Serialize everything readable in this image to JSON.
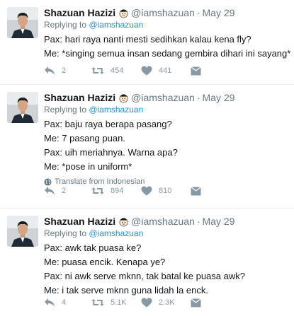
{
  "tweets": [
    {
      "name": "Shazuan Hazizi",
      "handle": "@iamshazuan",
      "sep": "·",
      "date": "May 29",
      "reply_prefix": "Replying to",
      "reply_to": "@iamshazuan",
      "lines": [
        "Pax: hari raya nanti mesti sedihkan kalau kena fly?",
        "Me: *singing semua insan sedang gembira dihari ini sayang*"
      ],
      "translate": "",
      "replies": "2",
      "retweets": "454",
      "likes": "441"
    },
    {
      "name": "Shazuan Hazizi",
      "handle": "@iamshazuan",
      "sep": "·",
      "date": "May 29",
      "reply_prefix": "Replying to",
      "reply_to": "@iamshazuan",
      "lines": [
        "Pax: baju raya berapa pasang?",
        "Me: 7 pasang puan.",
        "Pax: uih meriahnya. Warna apa?",
        "Me: *pose in uniform*"
      ],
      "translate": "Translate from Indonesian",
      "replies": "2",
      "retweets": "894",
      "likes": "810"
    },
    {
      "name": "Shazuan Hazizi",
      "handle": "@iamshazuan",
      "sep": "·",
      "date": "May 29",
      "reply_prefix": "Replying to",
      "reply_to": "@iamshazuan",
      "lines": [
        "Pax: awk tak puasa ke?",
        "Me: puasa encik. Kenapa ye?",
        "Pax: ni awk serve mknn, tak batal ke puasa awk?",
        "Me: i tak serve mknn guna lidah la enck."
      ],
      "translate": "",
      "replies": "4",
      "retweets": "5.1K",
      "likes": "2.3K"
    }
  ],
  "icons": {
    "reply": "reply-icon",
    "retweet": "retweet-icon",
    "like": "heart-icon",
    "dm": "envelope-icon",
    "translate": "globe-icon",
    "emoji": "face-emoji-icon"
  },
  "colors": {
    "text": "#14171a",
    "muted": "#657786",
    "link": "#1b95e0",
    "action": "#8899a6"
  }
}
